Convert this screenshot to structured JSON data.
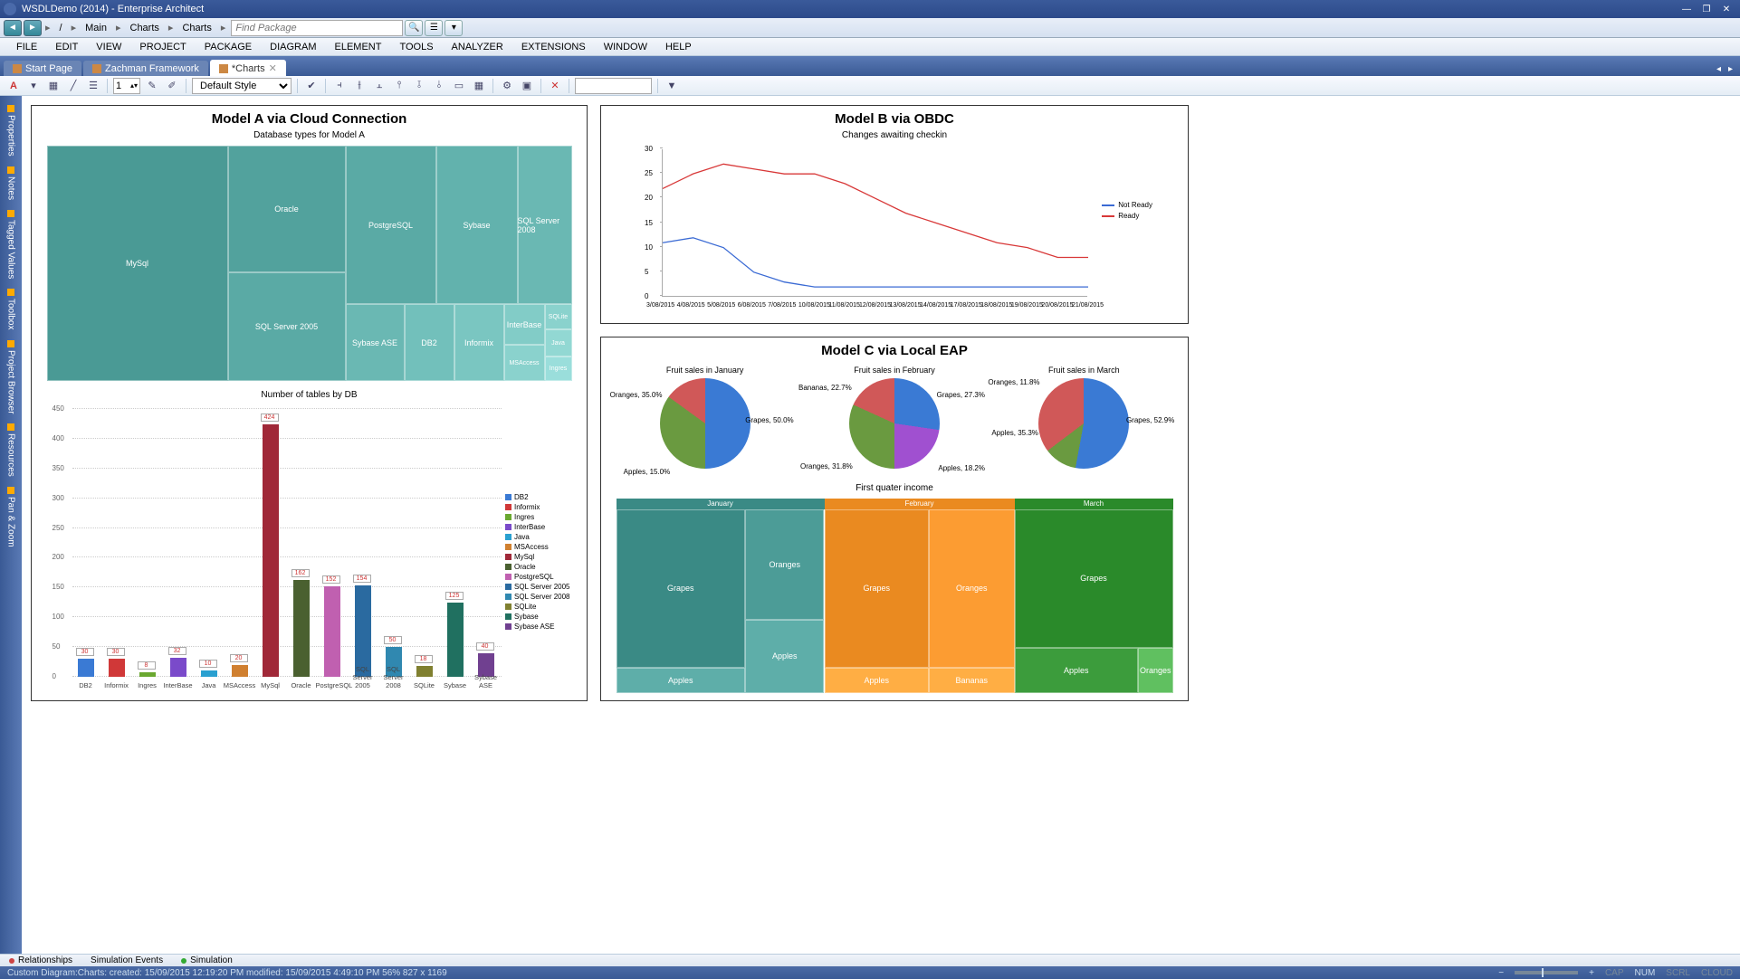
{
  "titlebar": {
    "text": "WSDLDemo (2014) - Enterprise Architect"
  },
  "breadcrumb": {
    "root": "/",
    "items": [
      "Main",
      "Charts",
      "Charts"
    ]
  },
  "findPackage": {
    "placeholder": "Find Package"
  },
  "menu": [
    "FILE",
    "EDIT",
    "VIEW",
    "PROJECT",
    "PACKAGE",
    "DIAGRAM",
    "ELEMENT",
    "TOOLS",
    "ANALYZER",
    "EXTENSIONS",
    "WINDOW",
    "HELP"
  ],
  "tabs": [
    {
      "label": "Start Page",
      "active": false
    },
    {
      "label": "Zachman Framework",
      "active": false
    },
    {
      "label": "*Charts",
      "active": true
    }
  ],
  "toolbar": {
    "spin": "1",
    "style": "Default Style"
  },
  "leftDock": [
    "Properties",
    "Notes",
    "Tagged Values",
    "Toolbox",
    "Project Browser",
    "Resources",
    "Pan & Zoom"
  ],
  "bottomTabs": [
    {
      "label": "Relationships",
      "dot": "#c44"
    },
    {
      "label": "Simulation Events",
      "dot": null
    },
    {
      "label": "Simulation",
      "dot": "#3a3"
    }
  ],
  "status": {
    "left": "Custom Diagram:Charts:   created: 15/09/2015 12:19:20 PM   modified: 15/09/2015 4:49:10 PM   56%   827 x 1169",
    "cap": "CAP",
    "num": "NUM",
    "scrl": "SCRL",
    "cloud": "CLOUD"
  },
  "panelA": {
    "title": "Model A via Cloud Connection",
    "sub1": "Database types for Model A",
    "sub2": "Number of tables by DB"
  },
  "panelB": {
    "title": "Model B via OBDC",
    "sub": "Changes awaiting checkin"
  },
  "panelC": {
    "title": "Model C via Local EAP",
    "pie1": "Fruit sales in January",
    "pie2": "Fruit sales in February",
    "pie3": "Fruit sales in March",
    "sub2": "First quater income"
  },
  "chart_data": [
    {
      "type": "treemap",
      "title": "Database types for Model A",
      "items": [
        {
          "name": "MySql",
          "value": 424
        },
        {
          "name": "Oracle",
          "value": 162
        },
        {
          "name": "SQL Server 2005",
          "value": 120
        },
        {
          "name": "PostgreSQL",
          "value": 152
        },
        {
          "name": "Sybase",
          "value": 125
        },
        {
          "name": "SQL Server 2008",
          "value": 46
        },
        {
          "name": "Sybase ASE",
          "value": 40
        },
        {
          "name": "DB2",
          "value": 30
        },
        {
          "name": "Informix",
          "value": 30
        },
        {
          "name": "InterBase",
          "value": 32
        },
        {
          "name": "SQLite",
          "value": 18
        },
        {
          "name": "Java",
          "value": 10
        },
        {
          "name": "MSAccess",
          "value": 20
        },
        {
          "name": "Ingres",
          "value": 8
        }
      ]
    },
    {
      "type": "bar",
      "title": "Number of tables by DB",
      "ylabel": "",
      "xlabel": "",
      "ylim": [
        0,
        450
      ],
      "categories": [
        "DB2",
        "Informix",
        "Ingres",
        "InterBase",
        "Java",
        "MSAccess",
        "MySql",
        "Oracle",
        "PostgreSQL",
        "SQL Server 2005",
        "SQL Server 2008",
        "SQLite",
        "Sybase",
        "Sybase ASE"
      ],
      "values": [
        30,
        30,
        8,
        32,
        10,
        20,
        424,
        162,
        152,
        154,
        50,
        18,
        125,
        40
      ],
      "colors": [
        "#3a7ad4",
        "#d03838",
        "#6aa830",
        "#7a4aca",
        "#2aa0d0",
        "#d08030",
        "#a02838",
        "#4a6030",
        "#c060b0",
        "#2a6aa0",
        "#3088b0",
        "#808030",
        "#207060",
        "#704090"
      ]
    },
    {
      "type": "line",
      "title": "Changes awaiting checkin",
      "x": [
        "3/08/2015",
        "4/08/2015",
        "5/08/2015",
        "6/08/2015",
        "7/08/2015",
        "10/08/2015",
        "11/08/2015",
        "12/08/2015",
        "13/08/2015",
        "14/08/2015",
        "17/08/2015",
        "18/08/2015",
        "19/08/2015",
        "20/08/2015",
        "21/08/2015"
      ],
      "ylim": [
        0,
        30
      ],
      "series": [
        {
          "name": "Not Ready",
          "color": "#3a6ad4",
          "values": [
            11,
            12,
            10,
            5,
            3,
            2,
            2,
            2,
            2,
            2,
            2,
            2,
            2,
            2,
            2
          ]
        },
        {
          "name": "Ready",
          "color": "#d83838",
          "values": [
            22,
            25,
            27,
            26,
            25,
            25,
            23,
            20,
            17,
            15,
            13,
            11,
            10,
            8,
            8
          ]
        }
      ]
    },
    {
      "type": "pie",
      "title": "Fruit sales in January",
      "slices": [
        {
          "name": "Grapes",
          "value": 50.0,
          "color": "#3a7ad4"
        },
        {
          "name": "Oranges",
          "value": 35.0,
          "color": "#6a9a40"
        },
        {
          "name": "Apples",
          "value": 15.0,
          "color": "#d05858"
        }
      ]
    },
    {
      "type": "pie",
      "title": "Fruit sales in February",
      "slices": [
        {
          "name": "Grapes",
          "value": 27.3,
          "color": "#3a7ad4"
        },
        {
          "name": "Bananas",
          "value": 22.7,
          "color": "#a050d0"
        },
        {
          "name": "Oranges",
          "value": 31.8,
          "color": "#6a9a40"
        },
        {
          "name": "Apples",
          "value": 18.2,
          "color": "#d05858"
        }
      ]
    },
    {
      "type": "pie",
      "title": "Fruit sales in March",
      "slices": [
        {
          "name": "Grapes",
          "value": 52.9,
          "color": "#3a7ad4"
        },
        {
          "name": "Oranges",
          "value": 11.8,
          "color": "#6a9a40"
        },
        {
          "name": "Apples",
          "value": 35.3,
          "color": "#d05858"
        }
      ]
    },
    {
      "type": "treemap",
      "title": "First quater income",
      "groups": [
        {
          "name": "January",
          "color": "#3a8a85",
          "items": [
            {
              "name": "Grapes",
              "value": 50
            },
            {
              "name": "Oranges",
              "value": 35
            },
            {
              "name": "Apples",
              "value": 15
            }
          ]
        },
        {
          "name": "February",
          "color": "#ea8a20",
          "items": [
            {
              "name": "Grapes",
              "value": 27
            },
            {
              "name": "Oranges",
              "value": 32
            },
            {
              "name": "Apples",
              "value": 18
            },
            {
              "name": "Bananas",
              "value": 23
            }
          ]
        },
        {
          "name": "March",
          "color": "#2a8a2a",
          "items": [
            {
              "name": "Grapes",
              "value": 53
            },
            {
              "name": "Apples",
              "value": 35
            },
            {
              "name": "Oranges",
              "value": 12
            }
          ]
        }
      ]
    }
  ]
}
